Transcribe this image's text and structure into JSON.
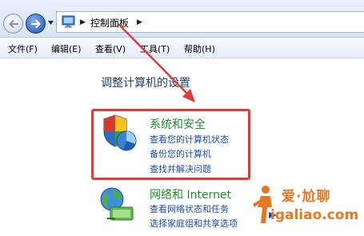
{
  "address_bar": {
    "breadcrumb": "控制面板",
    "separator": "▶"
  },
  "menu": [
    {
      "label": "文件(F)"
    },
    {
      "label": "编辑(E)"
    },
    {
      "label": "查看(V)"
    },
    {
      "label": "工具(T)"
    },
    {
      "label": "帮助(H)"
    }
  ],
  "main": {
    "heading": "调整计算机的设置",
    "categories": [
      {
        "title": "系统和安全",
        "icon": "shield-pie-icon",
        "links": [
          "查看您的计算机状态",
          "备份您的计算机",
          "查找并解决问题"
        ]
      },
      {
        "title": "网络和 Internet",
        "icon": "network-globe-icon",
        "links": [
          "查看网络状态和任务",
          "选择家庭组和共享选项"
        ]
      }
    ]
  },
  "watermark": {
    "top": "爱·尬聊",
    "bottom": "igaliao.com"
  },
  "colors": {
    "highlight_box": "#e03a3a",
    "category_title": "#1a8f2a",
    "link": "#1a4bb8",
    "heading": "#1e3f6a",
    "watermark": "#e87722"
  }
}
